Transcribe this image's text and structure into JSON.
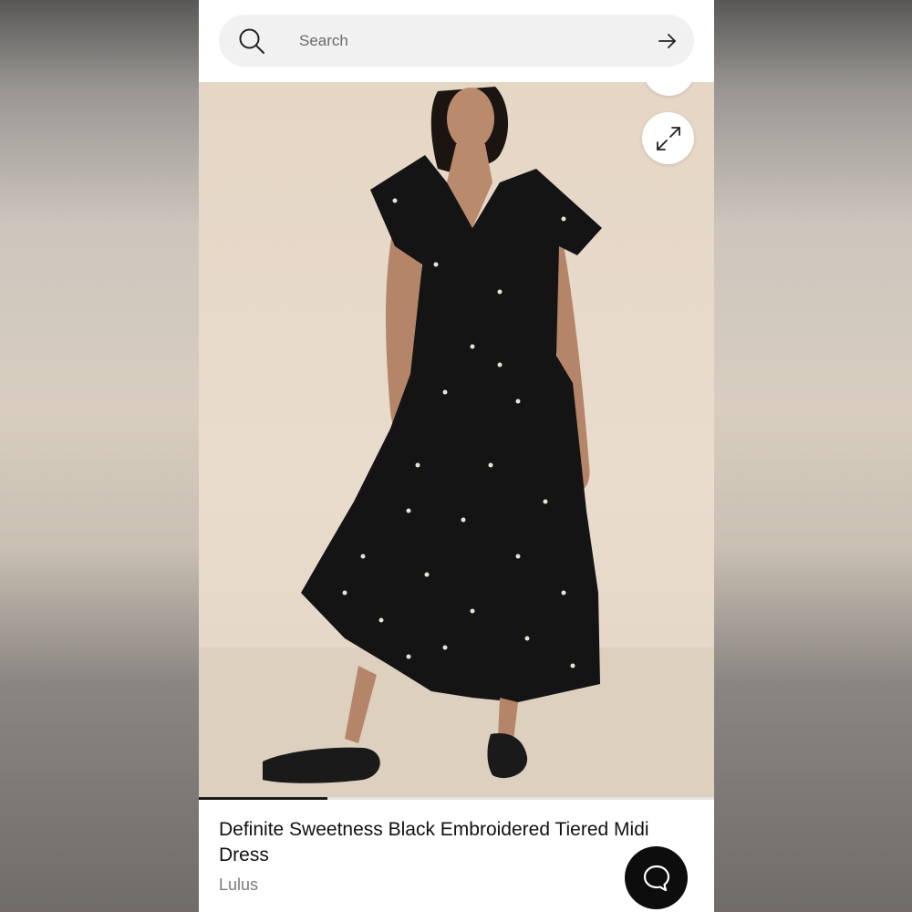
{
  "search": {
    "placeholder": "Search",
    "icon": "search-icon",
    "submit_icon": "arrow-right-icon"
  },
  "gallery": {
    "expand_icon": "expand-icon",
    "image_position": 0.25
  },
  "product": {
    "title": "Definite Sweetness Black Embroidered Tiered Midi Dress",
    "brand": "Lulus"
  },
  "chat": {
    "icon": "chat-bubble-icon"
  },
  "colors": {
    "background": "#ffffff",
    "search_bg": "#f1f1f1",
    "photo_backdrop": "#e6d8c8",
    "dress": "#141414",
    "accent_dark": "#0d0d0d"
  }
}
